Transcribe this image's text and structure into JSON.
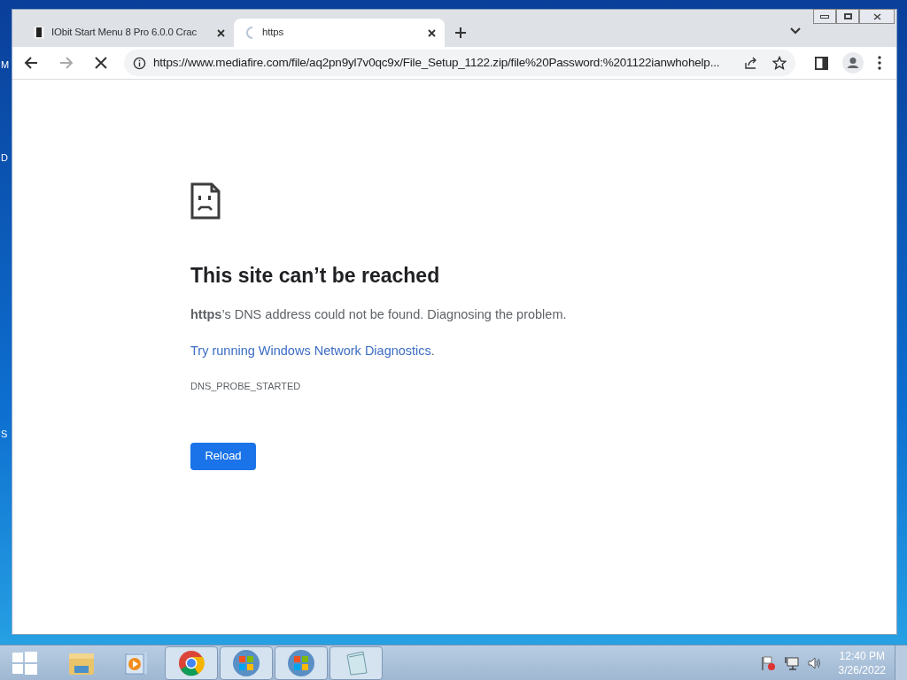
{
  "desktop_labels": [
    "M",
    "D",
    "S"
  ],
  "tabs": [
    {
      "title": "IObit Start Menu 8 Pro 6.0.0 Crac",
      "selected": false,
      "loading": false
    },
    {
      "title": "https",
      "selected": true,
      "loading": true
    }
  ],
  "address_bar": {
    "url": "https://www.mediafire.com/file/aq2pn9yl7v0qc9x/File_Setup_1122.zip/file%20Password:%201122ianwhohelp..."
  },
  "page_loading": true,
  "error_page": {
    "heading": "This site can’t be reached",
    "message": "**https**’s DNS address could not be found. Diagnosing the problem.",
    "link": "Try running Windows Network Diagnostics",
    "link_suffix": ".",
    "error_code": "DNS_PROBE_STARTED",
    "button": "Reload"
  },
  "taskbar": {
    "apps": [
      {
        "kind": "explorer",
        "selected": false
      },
      {
        "kind": "media",
        "selected": false
      },
      {
        "kind": "chrome",
        "selected": true
      },
      {
        "kind": "globe",
        "selected": true
      },
      {
        "kind": "globe",
        "selected": true
      },
      {
        "kind": "notepad",
        "selected": true
      }
    ],
    "time": "12:40 PM",
    "date": "3/26/2022"
  }
}
